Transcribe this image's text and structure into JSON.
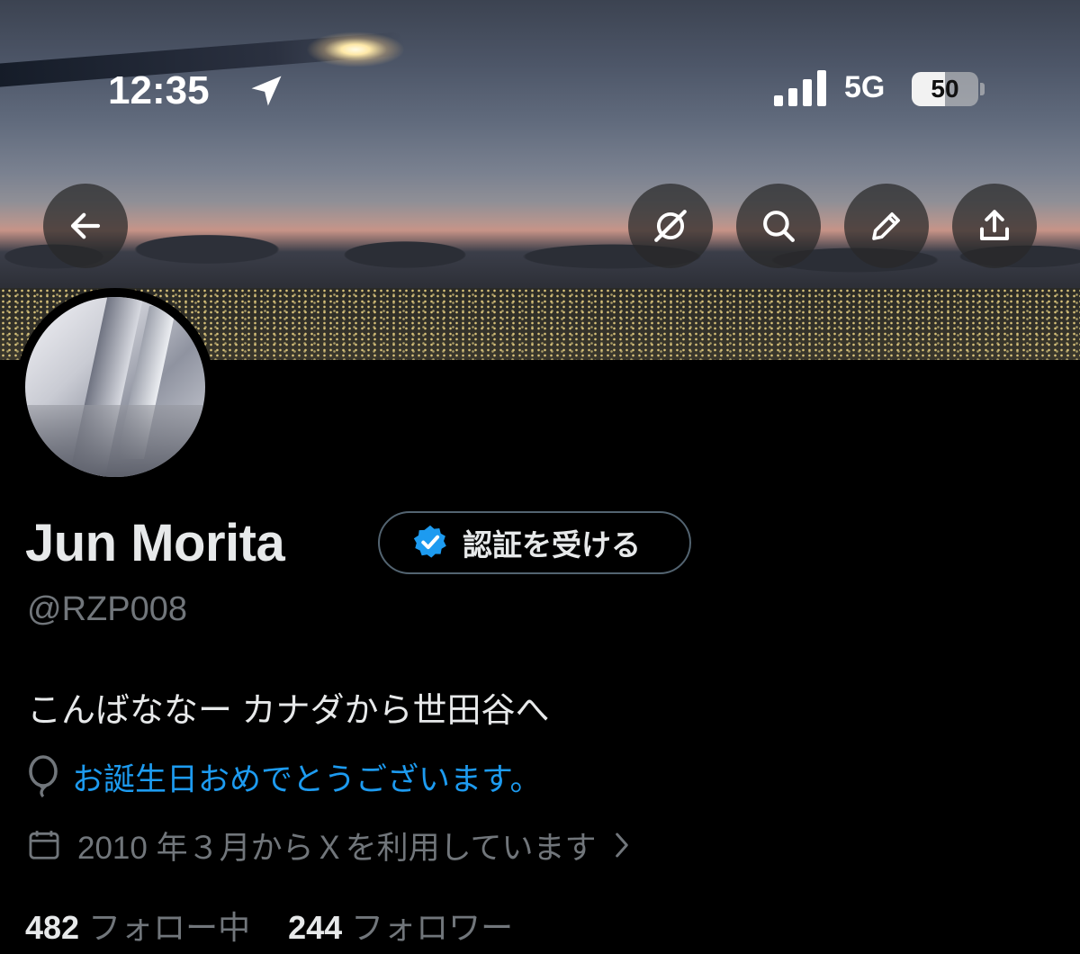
{
  "status_bar": {
    "time": "12:35",
    "network": "5G",
    "battery": "50"
  },
  "header": {
    "buttons": [
      {
        "name": "back",
        "icon": "arrow-left-icon"
      },
      {
        "name": "grok",
        "icon": "grok-icon"
      },
      {
        "name": "search",
        "icon": "search-icon"
      },
      {
        "name": "edit",
        "icon": "pencil-icon"
      },
      {
        "name": "share",
        "icon": "share-icon"
      }
    ]
  },
  "profile": {
    "name": "Jun Morita",
    "verify_label": "認証を受ける",
    "handle": "@RZP008",
    "bio": "こんばななー カナダから世田谷へ",
    "birthday": "お誕生日おめでとうございます。",
    "joined": "2010 年３月からＸを利用しています"
  },
  "stats": {
    "following_count": "482",
    "following_label": "フォロー中",
    "followers_count": "244",
    "followers_label": "フォロワー"
  },
  "colors": {
    "background": "#000000",
    "accent": "#1d9bf0",
    "text_primary": "#e7e9ea",
    "text_secondary": "#71767b"
  }
}
